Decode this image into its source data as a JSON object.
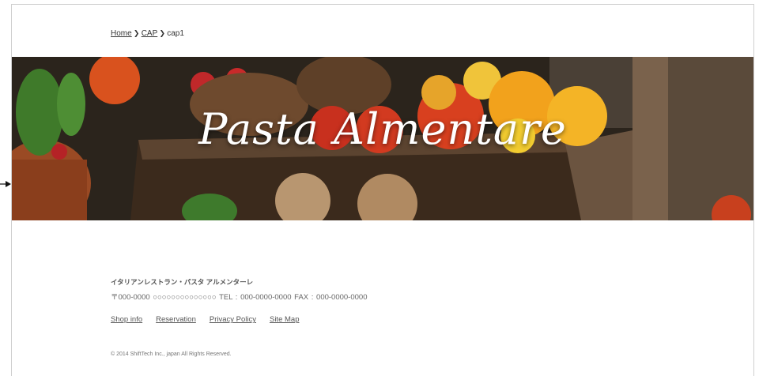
{
  "breadcrumb": {
    "home": "Home",
    "category": "CAP",
    "current": "cap1"
  },
  "hero": {
    "title": "Pasta Almentare"
  },
  "footer": {
    "name": "イタリアンレストラン・パスタ アルメンターレ",
    "address": "〒000-0000 ○○○○○○○○○○○○○○ TEL : 000-0000-0000 FAX : 000-0000-0000",
    "links": [
      "Shop info",
      "Reservation",
      "Privacy Policy",
      "Site Map"
    ],
    "copyright": "© 2014 ShiftTech Inc., japan All Rights Reserved."
  },
  "icons": {
    "breadcrumb_separator": "chevron-right-icon",
    "side_arrow": "arrow-right-icon"
  }
}
